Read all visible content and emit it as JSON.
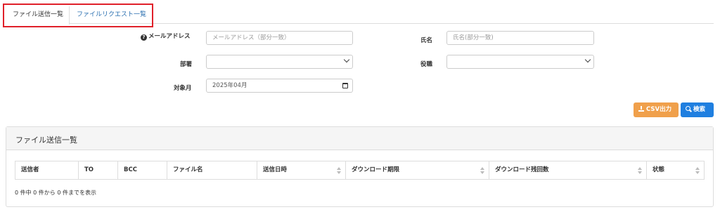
{
  "tabs": [
    {
      "label": "ファイル送信一覧",
      "active": true
    },
    {
      "label": "ファイルリクエスト一覧",
      "active": false
    }
  ],
  "form": {
    "email": {
      "label": "メールアドレス",
      "placeholder": "メールアドレス（部分一致）",
      "value": ""
    },
    "name": {
      "label": "氏名",
      "placeholder": "氏名(部分一致)",
      "value": ""
    },
    "department": {
      "label": "部署",
      "value": ""
    },
    "position": {
      "label": "役職",
      "value": ""
    },
    "target_month": {
      "label": "対象月",
      "value": "2025年04月"
    }
  },
  "buttons": {
    "csv_label": "CSV出力",
    "search_label": "検索"
  },
  "panel": {
    "title": "ファイル送信一覧",
    "columns": [
      "送信者",
      "TO",
      "BCC",
      "ファイル名",
      "送信日時",
      "ダウンロード期限",
      "ダウンロード残回数",
      "状態"
    ],
    "info": "0 件中 0 件から 0 件までを表示"
  },
  "colors": {
    "accent_link": "#2a6fb0",
    "csv_button": "#f0a04b",
    "search_button": "#1f7fe0",
    "highlight_border": "#e0202a"
  },
  "icons": [
    "question-circle-icon",
    "chevron-down-icon",
    "calendar-icon",
    "download-icon",
    "search-icon",
    "sort-icon"
  ]
}
